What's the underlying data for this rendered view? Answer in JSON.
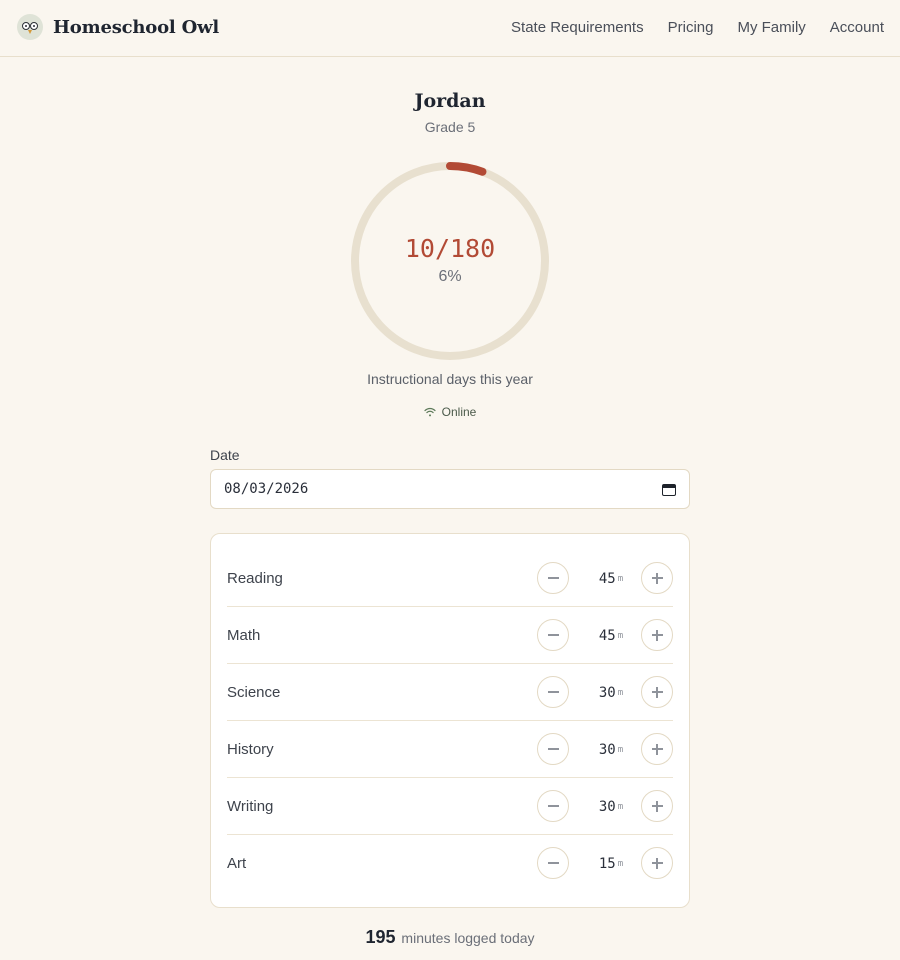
{
  "header": {
    "brand": "Homeschool Owl",
    "nav": [
      "State Requirements",
      "Pricing",
      "My Family",
      "Account"
    ]
  },
  "student": {
    "name": "Jordan",
    "grade": "Grade 5"
  },
  "progress": {
    "count_label": "10/180",
    "percent_label": "6%",
    "days_completed": 10,
    "days_required": 180,
    "caption": "Instructional days this year",
    "ring_color": "#b24a35",
    "track_color": "#e8e0cf"
  },
  "connection": {
    "status": "Online",
    "icon": "wifi-icon"
  },
  "date": {
    "label": "Date",
    "value": "08/03/2026"
  },
  "subjects": [
    {
      "name": "Reading",
      "minutes": "45",
      "unit": "m"
    },
    {
      "name": "Math",
      "minutes": "45",
      "unit": "m"
    },
    {
      "name": "Science",
      "minutes": "30",
      "unit": "m"
    },
    {
      "name": "History",
      "minutes": "30",
      "unit": "m"
    },
    {
      "name": "Writing",
      "minutes": "30",
      "unit": "m"
    },
    {
      "name": "Art",
      "minutes": "15",
      "unit": "m"
    }
  ],
  "total": {
    "value": "195",
    "label": "minutes logged today"
  }
}
